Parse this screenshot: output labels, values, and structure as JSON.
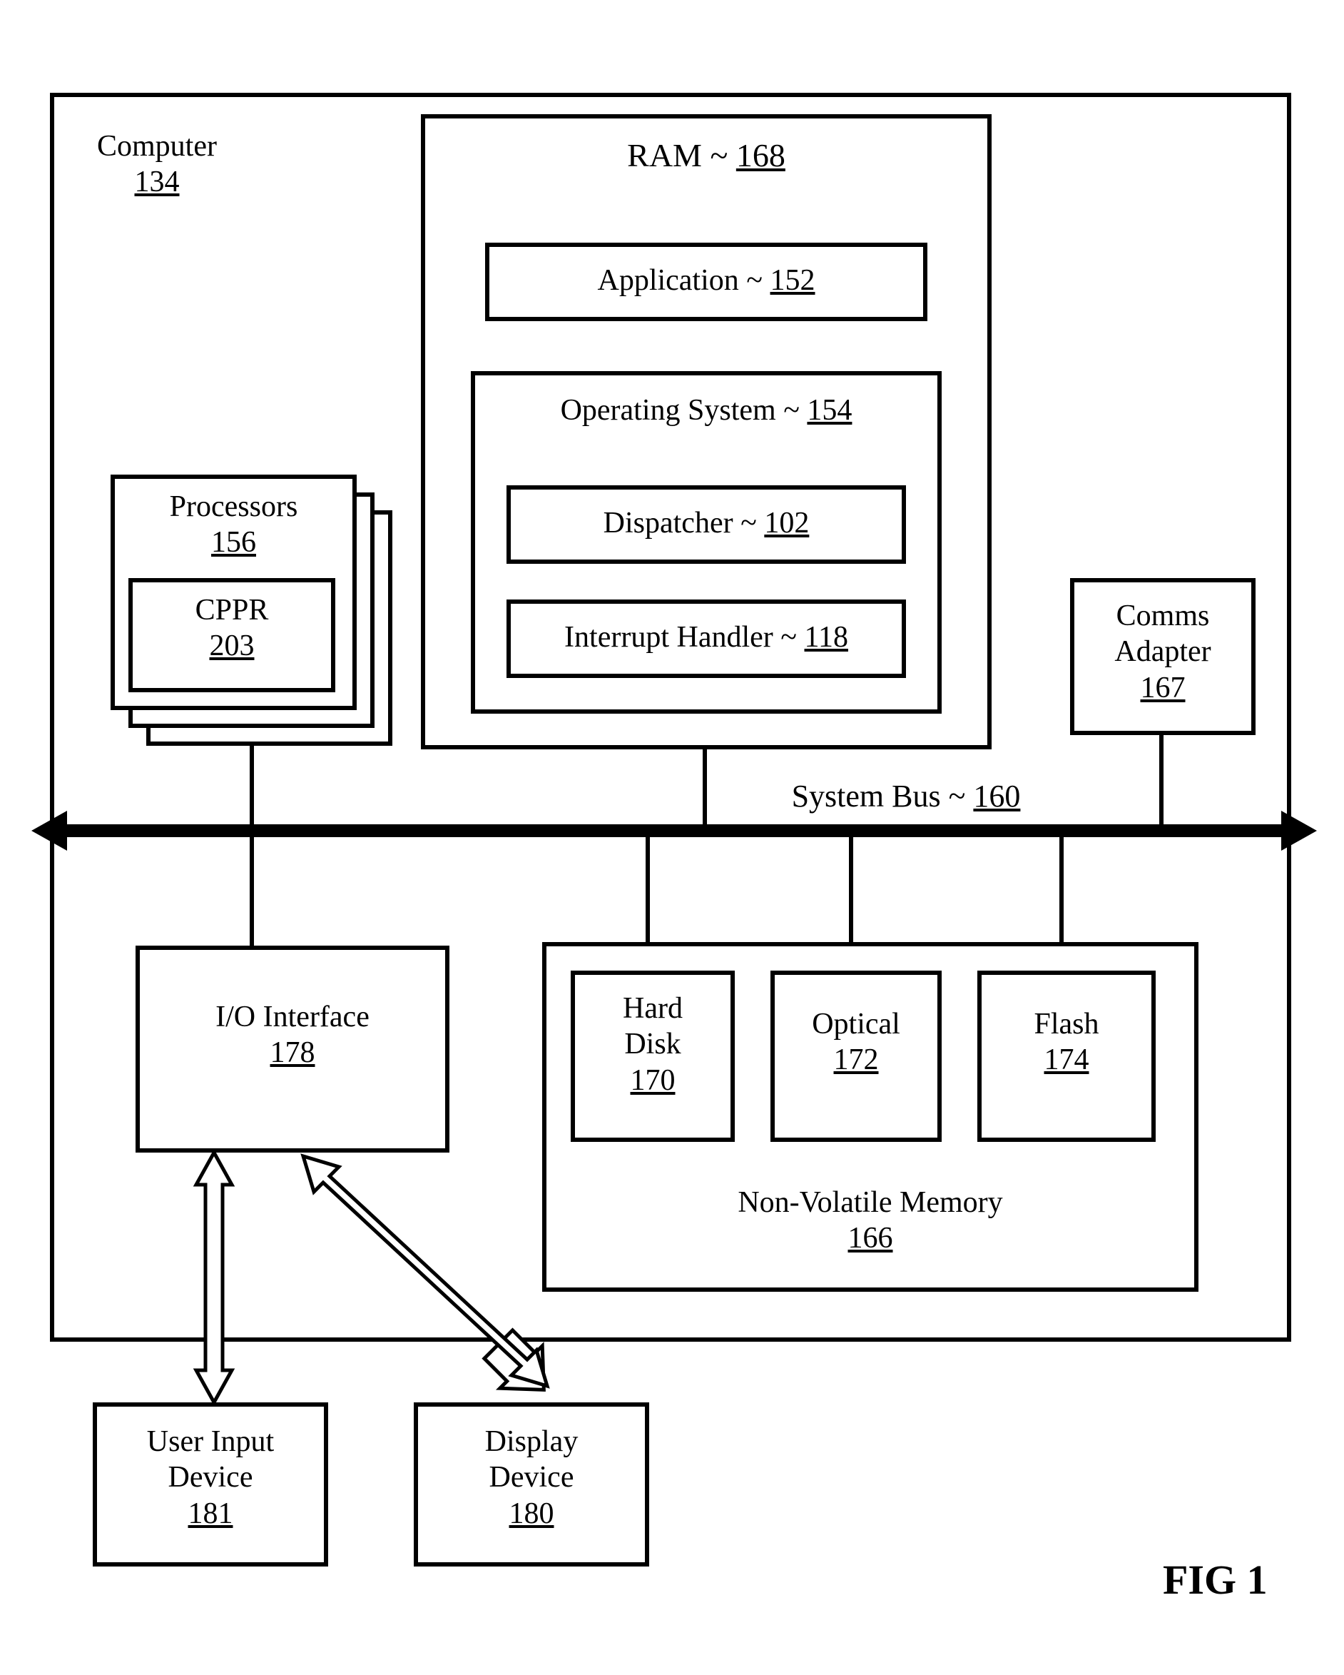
{
  "computer": {
    "label": "Computer",
    "ref": "134"
  },
  "processors": {
    "label": "Processors",
    "ref": "156"
  },
  "cppr": {
    "label": "CPPR",
    "ref": "203"
  },
  "ram": {
    "label": "RAM",
    "sep": "~",
    "ref": "168"
  },
  "application": {
    "label": "Application",
    "sep": "~",
    "ref": "152"
  },
  "os": {
    "label": "Operating System",
    "sep": "~",
    "ref": "154"
  },
  "dispatcher": {
    "label": "Dispatcher",
    "sep": "~",
    "ref": "102"
  },
  "interrupt": {
    "label": "Interrupt Handler",
    "sep": "~",
    "ref": "118"
  },
  "comms": {
    "label": "Comms Adapter",
    "ref": "167"
  },
  "systembus": {
    "label": "System Bus",
    "sep": "~",
    "ref": "160"
  },
  "io": {
    "label": "I/O Interface",
    "ref": "178"
  },
  "nvm": {
    "label": "Non-Volatile Memory",
    "ref": "166"
  },
  "harddisk": {
    "label": "Hard Disk",
    "ref": "170"
  },
  "optical": {
    "label": "Optical",
    "ref": "172"
  },
  "flash": {
    "label": "Flash",
    "ref": "174"
  },
  "userinput": {
    "label": "User Input Device",
    "ref": "181"
  },
  "display": {
    "label": "Display Device",
    "ref": "180"
  },
  "figure": "FIG 1"
}
